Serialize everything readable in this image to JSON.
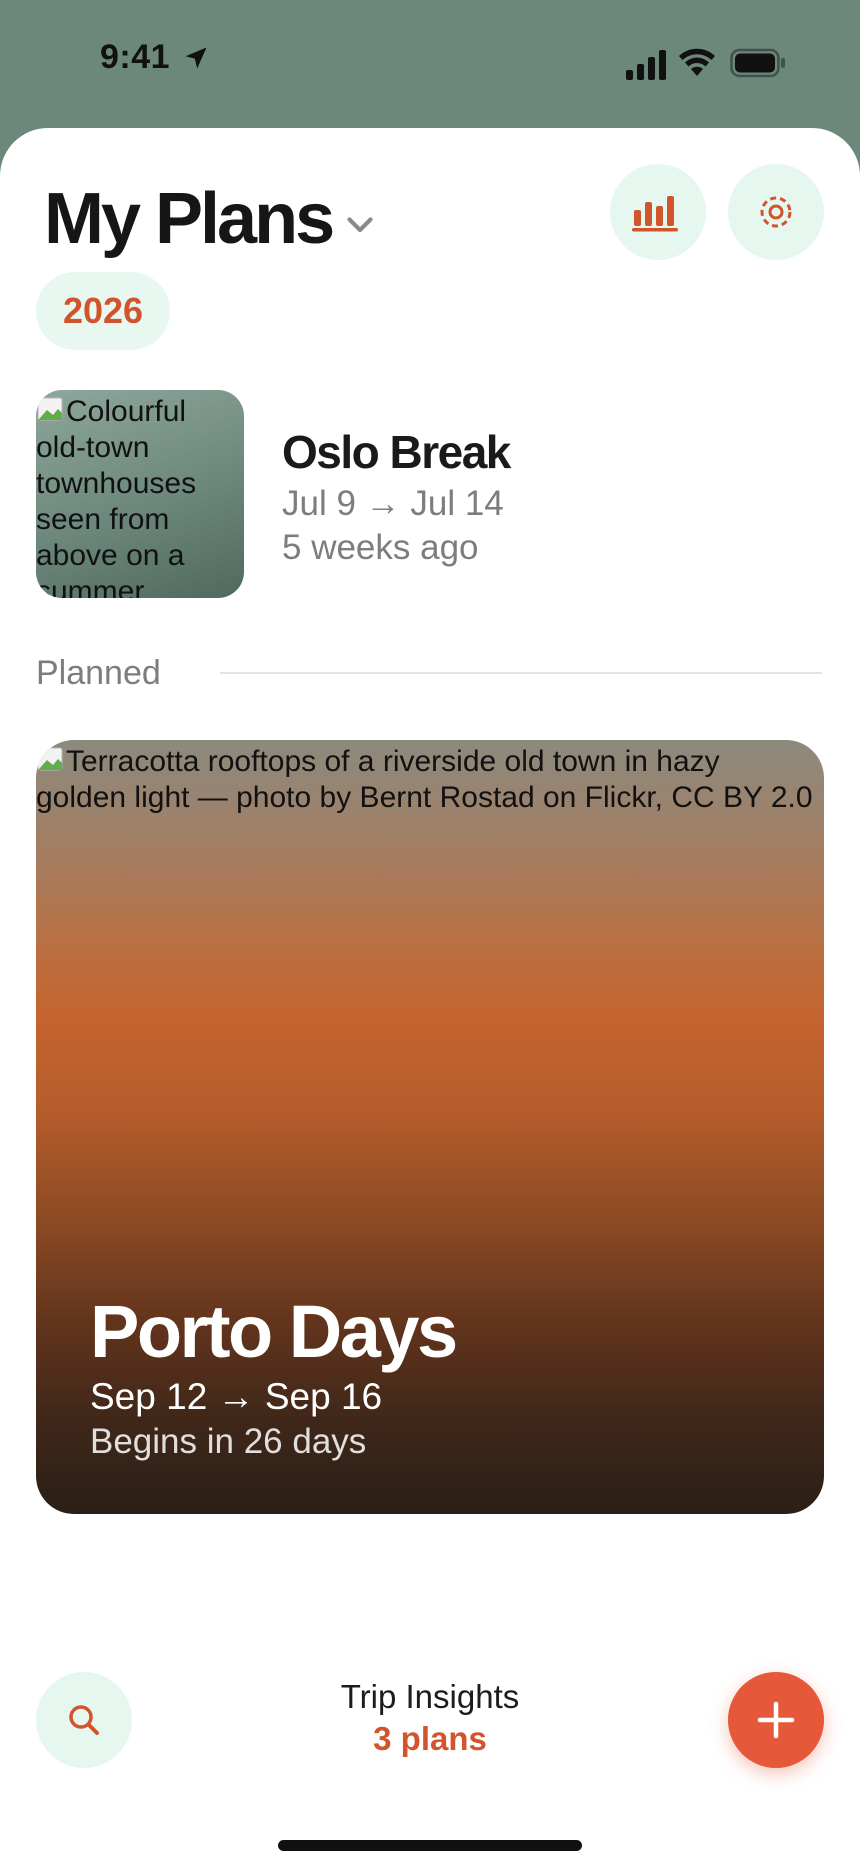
{
  "status_bar": {
    "time": "9:41",
    "icons": [
      "location-arrow-icon",
      "cellular-signal-icon",
      "wifi-icon",
      "battery-icon"
    ]
  },
  "header": {
    "title": "My Plans",
    "title_menu_icon": "chevron-down-icon",
    "stats_icon": "bar-chart-icon",
    "settings_icon": "settings-gear-icon"
  },
  "year_filter": {
    "label": "2026"
  },
  "recent_plan": {
    "image_alt": "Colourful old-town townhouses seen from above on a summer",
    "name": "Oslo Break",
    "dates": "Jul 9 → Jul 14",
    "relative_time": "5 weeks ago"
  },
  "planned_section": {
    "label": "Planned"
  },
  "featured_plan": {
    "image_alt": "Terracotta rooftops of a riverside old town in hazy golden light — photo by Bernt Rostad on Flickr, CC BY 2.0",
    "name": "Porto Days",
    "dates": "Sep 12 → Sep 16",
    "countdown": "Begins in 26 days"
  },
  "bottom_bar": {
    "search_icon": "search-icon",
    "insights_title": "Trip Insights",
    "insights_count": "3 plans",
    "add_icon": "plus-icon"
  },
  "colors": {
    "accent": "#d2542c",
    "add_button": "#e5593a",
    "chip_background": "#e8f8f1",
    "status_bar_background": "#6b887b"
  }
}
